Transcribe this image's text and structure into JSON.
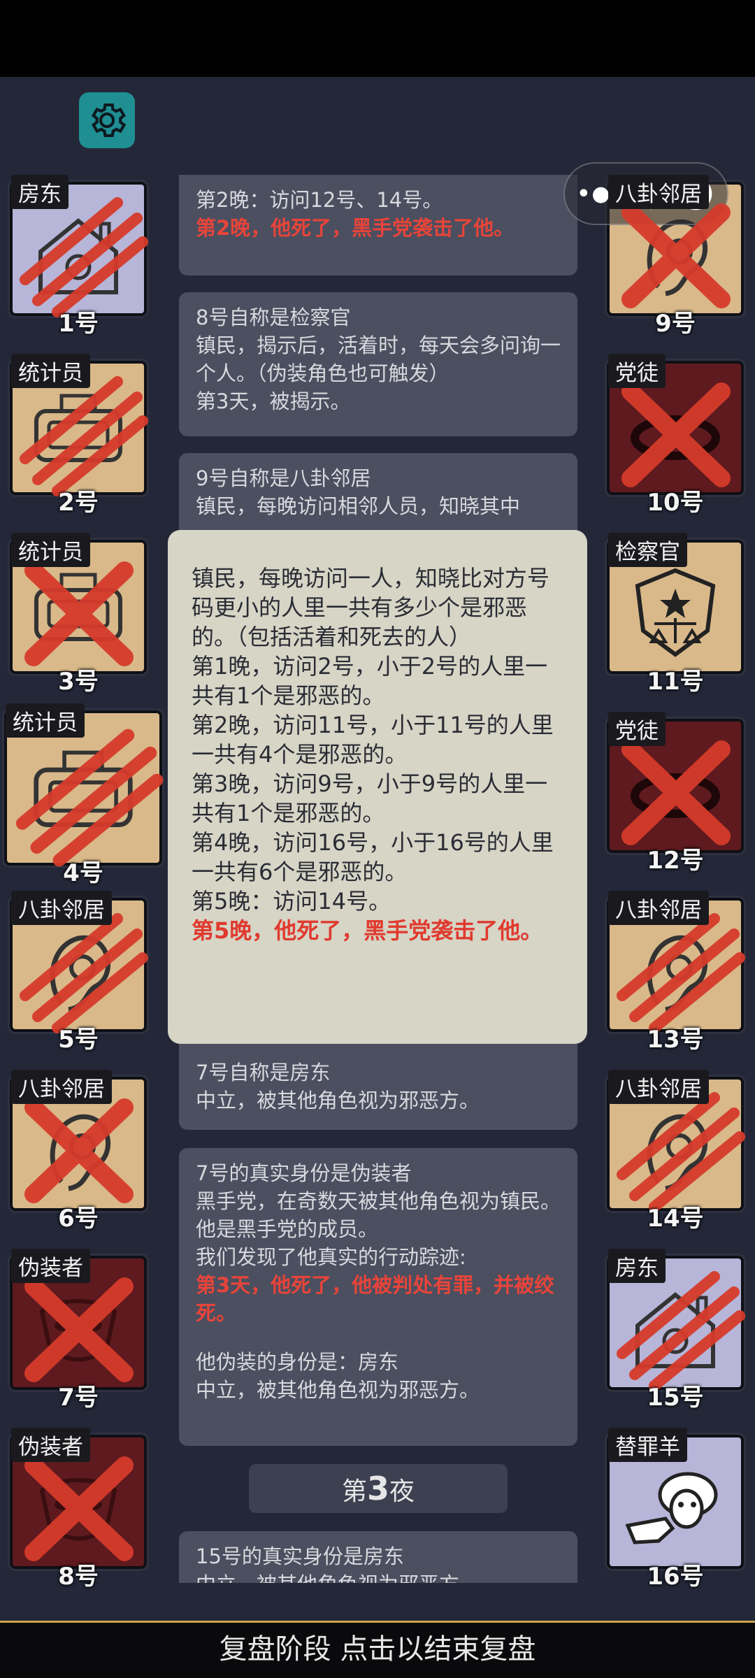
{
  "left_players": [
    {
      "role": "房东",
      "number": "1号",
      "bg": "lav",
      "mark": "claw",
      "art": "house"
    },
    {
      "role": "统计员",
      "number": "2号",
      "bg": "tan",
      "mark": "claw",
      "art": "machine"
    },
    {
      "role": "统计员",
      "number": "3号",
      "bg": "tan",
      "mark": "cross",
      "art": "machine"
    },
    {
      "role": "统计员",
      "number": "4号",
      "bg": "tan",
      "mark": "claw",
      "art": "machine"
    },
    {
      "role": "八卦邻居",
      "number": "5号",
      "bg": "tan",
      "mark": "claw",
      "art": "ear"
    },
    {
      "role": "八卦邻居",
      "number": "6号",
      "bg": "tan",
      "mark": "cross",
      "art": "ear"
    },
    {
      "role": "伪装者",
      "number": "7号",
      "bg": "red",
      "mark": "cross",
      "art": "mask"
    },
    {
      "role": "伪装者",
      "number": "8号",
      "bg": "red",
      "mark": "cross",
      "art": "mask"
    }
  ],
  "right_players": [
    {
      "role": "八卦邻居",
      "number": "9号",
      "bg": "tan",
      "mark": "cross",
      "art": "ear"
    },
    {
      "role": "党徒",
      "number": "10号",
      "bg": "red",
      "mark": "cross",
      "art": "ring"
    },
    {
      "role": "检察官",
      "number": "11号",
      "bg": "tan",
      "mark": "none",
      "art": "badge"
    },
    {
      "role": "党徒",
      "number": "12号",
      "bg": "red",
      "mark": "cross",
      "art": "ring"
    },
    {
      "role": "八卦邻居",
      "number": "13号",
      "bg": "tan",
      "mark": "claw",
      "art": "ear"
    },
    {
      "role": "八卦邻居",
      "number": "14号",
      "bg": "tan",
      "mark": "claw",
      "art": "ear"
    },
    {
      "role": "房东",
      "number": "15号",
      "bg": "lav",
      "mark": "claw",
      "art": "house"
    },
    {
      "role": "替罪羊",
      "number": "16号",
      "bg": "lav",
      "mark": "none",
      "art": "sheep"
    }
  ],
  "log": {
    "m1_line1": "第2晚：访问12号、14号。",
    "m1_red": "第2晚，他死了，黑手党袭击了他。",
    "m2_title": "8号自称是检察官",
    "m2_body": "镇民，揭示后，活着时，每天会多问询一个人。（伪装角色也可触发）",
    "m2_day": "第3天，被揭示。",
    "m3_title": "9号自称是八卦邻居",
    "m3_body": "镇民，每晚访问相邻人员，知晓其中",
    "m4_title": "7号自称是房东",
    "m4_body": "中立，被其他角色视为邪恶方。",
    "m5_title": "7号的真实身份是伪装者",
    "m5_body1": "黑手党，在奇数天被其他角色视为镇民。",
    "m5_body2": "他是黑手党的成员。",
    "m5_body3": "我们发现了他真实的行动踪迹:",
    "m5_red": "第3天，他死了，他被判处有罪，并被绞死。",
    "m5_disguise": "他伪装的身份是：房东",
    "m5_disguise_desc": "中立，被其他角色视为邪恶方。",
    "night_prefix": "第",
    "night_num": "3",
    "night_suffix": "夜",
    "m6_title": "15号的真实身份是房东",
    "m6_body": "中立，被其他角色视为邪恶方。"
  },
  "popup": {
    "desc": "镇民，每晚访问一人，知晓比对方号码更小的人里一共有多少个是邪恶的。（包括活着和死去的人）",
    "n1": "第1晚，访问2号，小于2号的人里一共有1个是邪恶的。",
    "n2": "第2晚，访问11号，小于11号的人里一共有4个是邪恶的。",
    "n3": "第3晚，访问9号，小于9号的人里一共有1个是邪恶的。",
    "n4": "第4晚，访问16号，小于16号的人里一共有6个是邪恶的。",
    "n5": "第5晚：访问14号。",
    "death": "第5晚，他死了，黑手党袭击了他。"
  },
  "bottom_bar": "复盘阶段 点击以结束复盘",
  "colors": {
    "background": "#232738",
    "accent_teal": "#1f8f93",
    "death_red": "#e8443a",
    "gold_border": "#c9a44a"
  }
}
